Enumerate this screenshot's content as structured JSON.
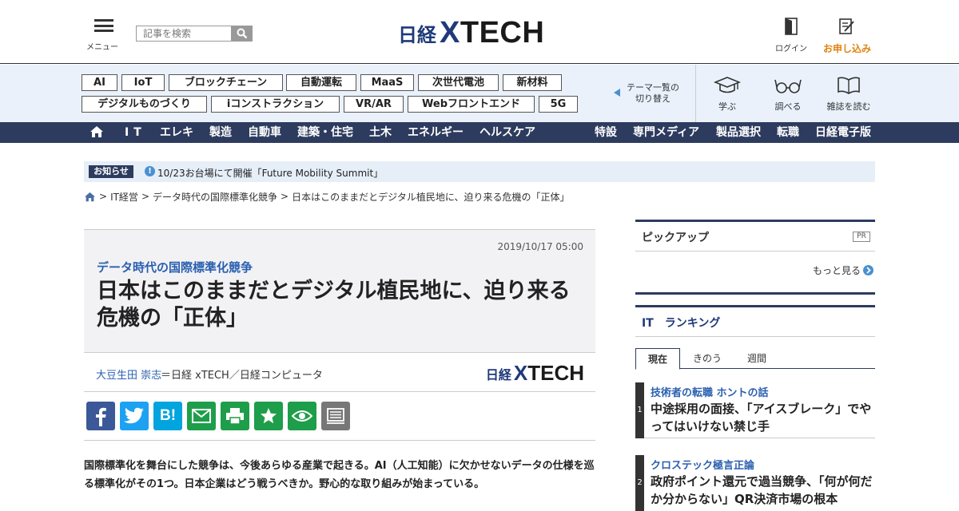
{
  "header": {
    "menu_label": "メニュー",
    "search_placeholder": "記事を検索",
    "logo_nikkei": "日経",
    "logo_x": "X",
    "logo_tech": "TECH",
    "login_label": "ログイン",
    "apply_label": "お申し込み"
  },
  "themes": [
    {
      "label": "AI"
    },
    {
      "label": "IoT"
    },
    {
      "label": "ブロックチェーン"
    },
    {
      "label": "自動運転"
    },
    {
      "label": "MaaS"
    },
    {
      "label": "次世代電池"
    },
    {
      "label": "新材料"
    },
    {
      "label": "デジタルものづくり"
    },
    {
      "label": "iコンストラクション"
    },
    {
      "label": "VR/AR"
    },
    {
      "label": "Webフロントエンド"
    },
    {
      "label": "5G"
    }
  ],
  "theme_switch": {
    "line1": "テーマ一覧の",
    "line2": "切り替え"
  },
  "icon_nav": [
    {
      "label": "学ぶ",
      "icon": "graduation-cap-icon"
    },
    {
      "label": "調べる",
      "icon": "glasses-icon"
    },
    {
      "label": "雑誌を読む",
      "icon": "open-book-icon"
    }
  ],
  "nav_left": [
    "IT",
    "エレキ",
    "製造",
    "自動車",
    "建築・住宅",
    "土木",
    "エネルギー",
    "ヘルスケア"
  ],
  "nav_right": [
    "特設",
    "専門メディア",
    "製品選択",
    "転職",
    "日経電子版"
  ],
  "notice": {
    "badge": "お知らせ",
    "text": "10/23お台場にて開催「Future Mobility Summit」"
  },
  "breadcrumb": [
    "IT経営",
    "データ時代の国際標準化競争",
    "日本はこのままだとデジタル植民地に、迫り来る危機の「正体」"
  ],
  "article": {
    "date": "2019/10/17 05:00",
    "series": "データ時代の国際標準化競争",
    "title": "日本はこのままだとデジタル植民地に、迫り来る危機の「正体」",
    "author": "大豆生田 崇志",
    "publication": "＝日経 xTECH／日経コンピュータ",
    "lead": "国際標準化を舞台にした競争は、今後あらゆる産業で起きる。AI（人工知能）に欠かせないデータの仕様を巡る標準化がその1つ。日本企業はどう戦うべきか。野心的な取り組みが始まっている。"
  },
  "share_buttons": [
    {
      "name": "facebook",
      "color": "#3b5998"
    },
    {
      "name": "twitter",
      "color": "#1da1f2"
    },
    {
      "name": "hatena",
      "color": "#00a4de"
    },
    {
      "name": "mail",
      "color": "#1e9e4a"
    },
    {
      "name": "print",
      "color": "#1e9e4a"
    },
    {
      "name": "favorite",
      "color": "#1e9e4a"
    },
    {
      "name": "watch",
      "color": "#1e9e4a"
    },
    {
      "name": "memo",
      "color": "#777777"
    }
  ],
  "pickup": {
    "title": "ピックアップ",
    "pr": "PR",
    "more": "もっと見る"
  },
  "ranking": {
    "title": "IT　ランキング",
    "tabs": [
      "現在",
      "きのう",
      "週間"
    ],
    "items": [
      {
        "rank": "1",
        "category": "技術者の転職 ホントの話",
        "title": "中途採用の面接、「アイスブレーク」でやってはいけない禁じ手"
      },
      {
        "rank": "2",
        "category": "クロステック極言正論",
        "title": "政府ポイント還元で過当競争、「何が何だか分からない」QR決済市場の根本"
      }
    ]
  }
}
